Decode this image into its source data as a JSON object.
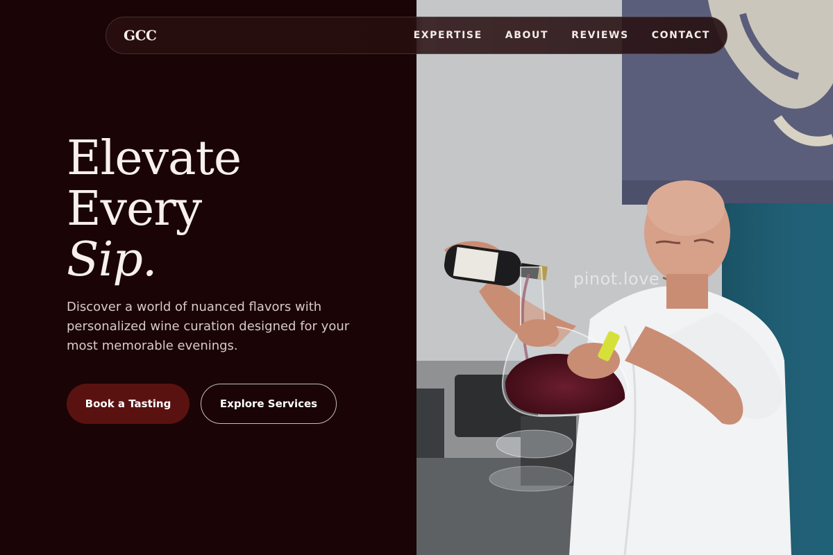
{
  "brand": {
    "logo": "GCC"
  },
  "nav": {
    "items": [
      {
        "label": "EXPERTISE"
      },
      {
        "label": "ABOUT"
      },
      {
        "label": "REVIEWS"
      },
      {
        "label": "CONTACT"
      }
    ]
  },
  "hero": {
    "title_line1": "Elevate",
    "title_line2": "Every",
    "title_line3": "Sip.",
    "subtitle": "Discover a world of nuanced flavors with personalized wine curation designed for your most memorable evenings.",
    "primary_cta": "Book a Tasting",
    "secondary_cta": "Explore Services"
  },
  "photo": {
    "watermark": "pinot.love",
    "subject": "man pouring red wine into decanter"
  },
  "colors": {
    "background": "#1a0405",
    "primary_button": "#5a1211",
    "text": "#f7f0ec"
  }
}
